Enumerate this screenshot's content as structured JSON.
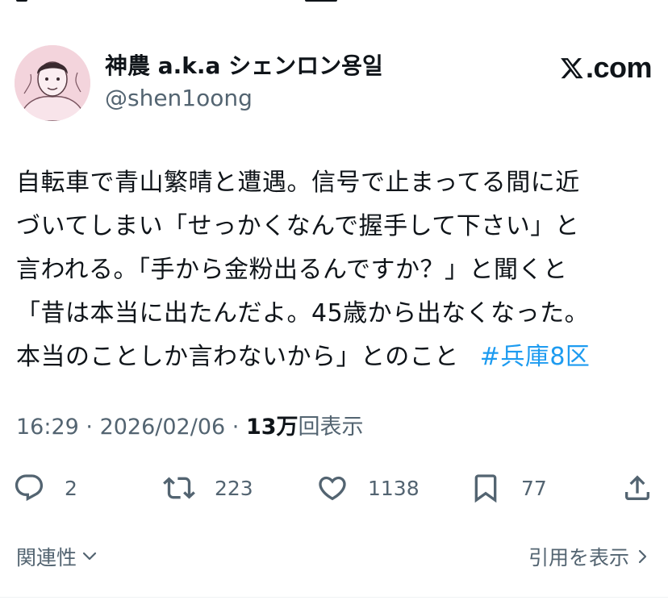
{
  "author": {
    "display_name": "神農 a.k.a シェンロン용일",
    "handle": "@shen1oong"
  },
  "brand": {
    "label": ".com"
  },
  "tweet": {
    "lines": [
      "自転車で青山繁晴と遭遇。信号で止まってる間に近",
      "づいてしまい「せっかくなんで握手して下さい」と",
      "言われる。「手から金粉出るんですか？」と聞くと",
      "「昔は本当に出たんだよ。45歳から出なくなった。",
      "本当のことしか言わないから」とのこと"
    ],
    "hashtag": "#兵庫8区"
  },
  "meta": {
    "time": "16:29",
    "sep1": " · ",
    "date": "2026/02/06",
    "sep2": " · ",
    "views": "13万",
    "views_label": "回表示"
  },
  "actions": {
    "replies": "2",
    "reposts": "223",
    "likes": "1138",
    "bookmarks": "77"
  },
  "footer": {
    "related": "関連性",
    "quotes": "引用を表示"
  },
  "colors": {
    "text": "#0f1419",
    "secondary": "#536471",
    "link": "#1d9bf0",
    "avatar_bg": "#f3d4dc"
  }
}
